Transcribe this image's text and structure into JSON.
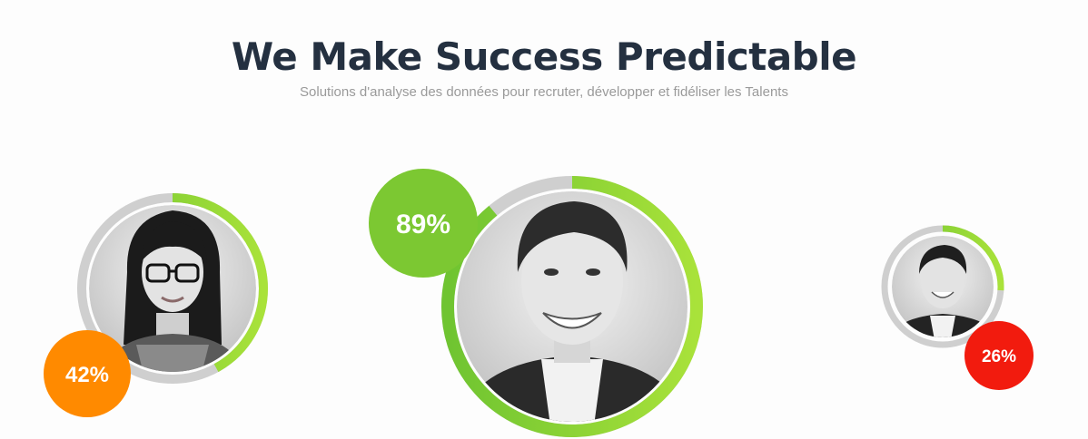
{
  "header": {
    "title": "We Make Success Predictable",
    "subtitle": "Solutions d'analyse des données pour recruter, développer et fidéliser les Talents"
  },
  "profiles": [
    {
      "name": "woman-with-glasses",
      "score": 0.42,
      "label": "42%",
      "color": "#ff8a00"
    },
    {
      "name": "smiling-man-center",
      "score": 0.89,
      "label": "89%",
      "color": "#7cc832"
    },
    {
      "name": "man-in-suit-right",
      "score": 0.26,
      "label": "26%",
      "color": "#f21b0e"
    }
  ],
  "colors": {
    "ring_track": "#cfcfcf",
    "ring_progress_dark": "#6fc431",
    "ring_progress_light": "#a9e23a",
    "title": "#243040",
    "subtitle": "#9a9a9a"
  }
}
